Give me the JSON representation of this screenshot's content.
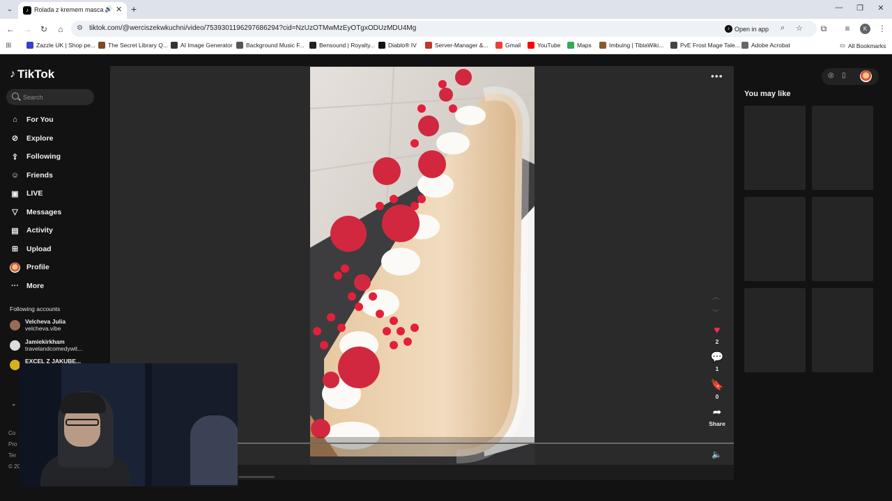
{
  "browser": {
    "tab_title": "Rolada z kremem mascarpone",
    "tab_favicon_icon": "tiktok-icon",
    "url": "tiktok.com/@werciszekwkuchni/video/7539301196297686294?cid=NzUzOTMwMzEyOTgxODUzMDU4Mg",
    "open_in_app": "Open in app",
    "bookmarks": [
      {
        "label": "Zazzle UK | Shop pe...",
        "color": "#3b3bd6"
      },
      {
        "label": "The Secret Library Q...",
        "color": "#7a4a2a"
      },
      {
        "label": "AI Image Generator",
        "color": "#333333"
      },
      {
        "label": "Background Music F...",
        "color": "#555555"
      },
      {
        "label": "Bensound | Royalty...",
        "color": "#222222"
      },
      {
        "label": "Diablo® IV",
        "color": "#111111"
      },
      {
        "label": "Server-Manager &...",
        "color": "#c0392b"
      },
      {
        "label": "Gmail",
        "color": "#ea4335"
      },
      {
        "label": "YouTube",
        "color": "#ff0000"
      },
      {
        "label": "Maps",
        "color": "#34a853"
      },
      {
        "label": "Imbuing | TibiaWiki...",
        "color": "#8a5a2a"
      },
      {
        "label": "PvE Frost Mage Tale...",
        "color": "#444444"
      },
      {
        "label": "Adobe Acrobat",
        "color": "#666666"
      }
    ],
    "all_bookmarks": "All Bookmarks",
    "profile_initial": "K"
  },
  "tiktok": {
    "logo": "TikTok",
    "search_placeholder": "Search",
    "nav": [
      {
        "label": "For You",
        "icon": "⌂"
      },
      {
        "label": "Explore",
        "icon": "⊘"
      },
      {
        "label": "Following",
        "icon": "⇪"
      },
      {
        "label": "Friends",
        "icon": "☺"
      },
      {
        "label": "LIVE",
        "icon": "▣"
      },
      {
        "label": "Messages",
        "icon": "▽"
      },
      {
        "label": "Activity",
        "icon": "▤"
      },
      {
        "label": "Upload",
        "icon": "⊞"
      },
      {
        "label": "Profile",
        "icon": ""
      },
      {
        "label": "More",
        "icon": "···"
      }
    ],
    "following_title": "Following accounts",
    "accounts": [
      {
        "name": "Velcheva Julia",
        "handle": "velcheva.vibe",
        "color": "#9a6b55"
      },
      {
        "name": "Jamiekirkham",
        "handle": "travelandcomedywit...",
        "color": "#dddddd"
      },
      {
        "name": "EXCEL Z JAKUBE...",
        "handle": "",
        "color": "#d4b21a"
      }
    ],
    "footer": [
      "Co",
      "Pro",
      "Ter",
      "© 20"
    ],
    "actions": {
      "likes": "2",
      "comments": "1",
      "saves": "0",
      "share": "Share"
    },
    "progress": 0.02,
    "you_may_like": "You may like",
    "colors": {
      "like": "#fe2c55",
      "background": "#121212"
    }
  }
}
